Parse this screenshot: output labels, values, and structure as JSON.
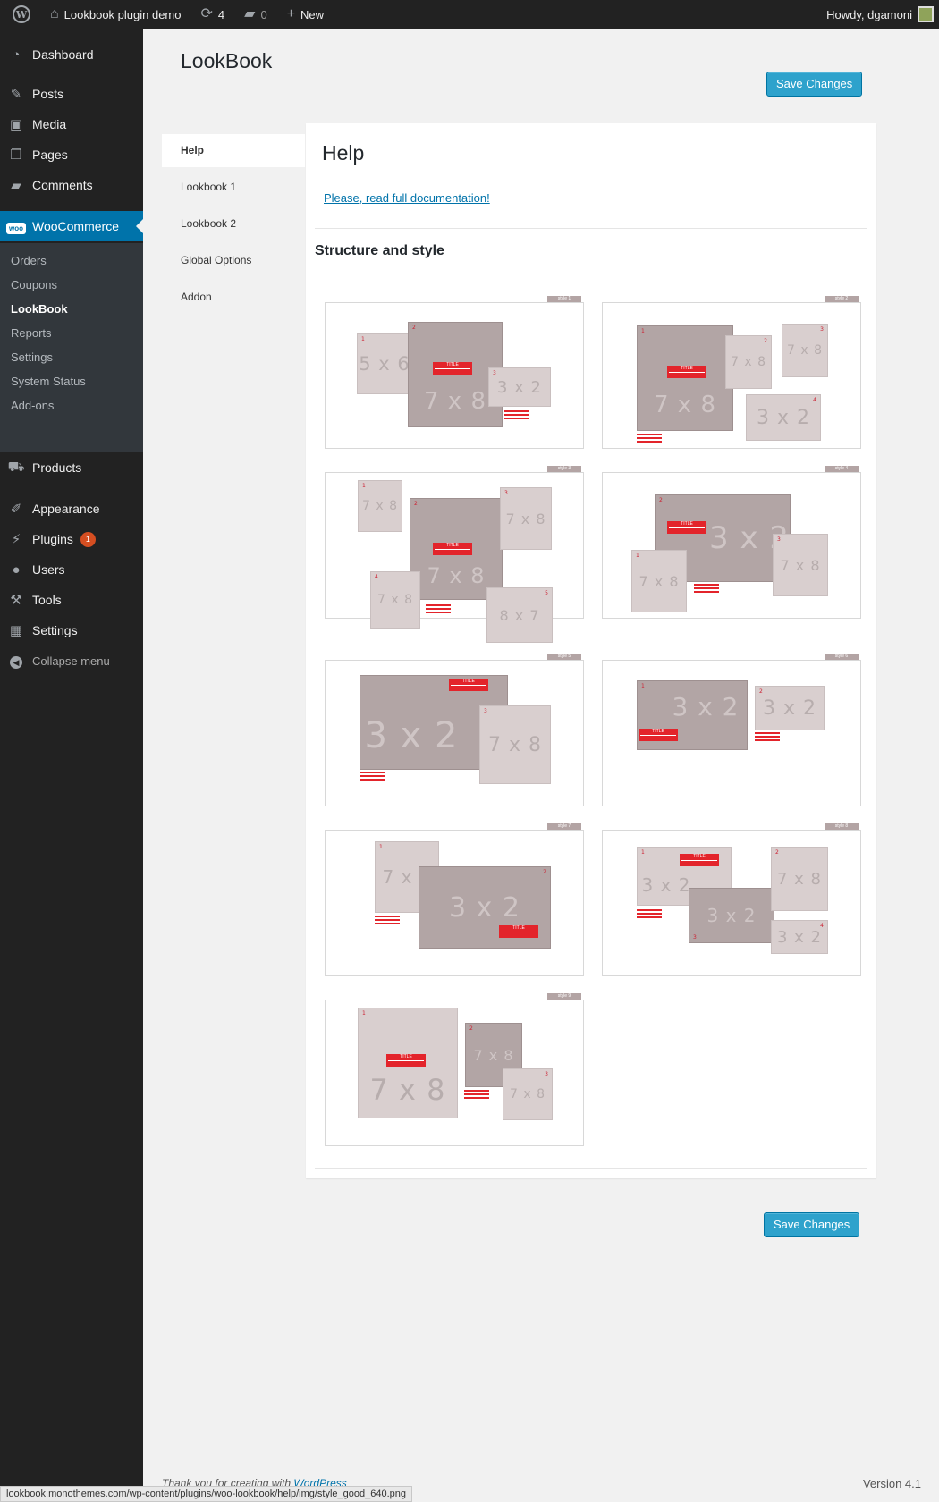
{
  "adminbar": {
    "site_name": "Lookbook plugin demo",
    "updates_count": "4",
    "comments_count": "0",
    "new_label": "New",
    "howdy": "Howdy, dgamoni"
  },
  "sidebar": {
    "items": [
      {
        "label": "Dashboard",
        "icon": "dashboard-icon"
      },
      {
        "label": "Posts",
        "icon": "pin-icon"
      },
      {
        "label": "Media",
        "icon": "media-icon"
      },
      {
        "label": "Pages",
        "icon": "pages-icon"
      },
      {
        "label": "Comments",
        "icon": "comment-icon"
      },
      {
        "label": "WooCommerce",
        "icon": "woocommerce-icon"
      },
      {
        "label": "Products",
        "icon": "cart-icon"
      },
      {
        "label": "Appearance",
        "icon": "brush-icon"
      },
      {
        "label": "Plugins",
        "icon": "plug-icon"
      },
      {
        "label": "Users",
        "icon": "user-icon"
      },
      {
        "label": "Tools",
        "icon": "wrench-icon"
      },
      {
        "label": "Settings",
        "icon": "settings-icon"
      },
      {
        "label": "Collapse menu",
        "icon": "collapse-icon"
      }
    ],
    "woo_badge": "woo",
    "plugins_badge": "1",
    "submenu": [
      "Orders",
      "Coupons",
      "LookBook",
      "Reports",
      "Settings",
      "System Status",
      "Add-ons"
    ]
  },
  "page": {
    "title": "LookBook",
    "save_label": "Save Changes"
  },
  "tabs": [
    "Help",
    "Lookbook 1",
    "Lookbook 2",
    "Global Options",
    "Addon"
  ],
  "panel": {
    "heading": "Help",
    "doc_link": "Please, read full documentation!",
    "section_title": "Structure and style"
  },
  "styles": {
    "tags": [
      "style 1",
      "style 2",
      "style 3",
      "style 4",
      "style 5",
      "style 6",
      "style 7",
      "style 8",
      "style 9"
    ],
    "title_text": "TITLE",
    "desc_text": "description",
    "sizes": {
      "s5x6": "5 x 6",
      "s7x8": "7 x 8",
      "s3x2": "3 x 2",
      "s8x7": "8 x 7"
    },
    "nums": {
      "n1": "1",
      "n2": "2",
      "n3": "3",
      "n4": "4",
      "n5": "5"
    }
  },
  "footer": {
    "thanks": "Thank you for creating with",
    "wp_link": "WordPress",
    "version": "Version 4.1",
    "status_url": "lookbook.monothemes.com/wp-content/plugins/woo-lookbook/help/img/style_good_640.png"
  }
}
